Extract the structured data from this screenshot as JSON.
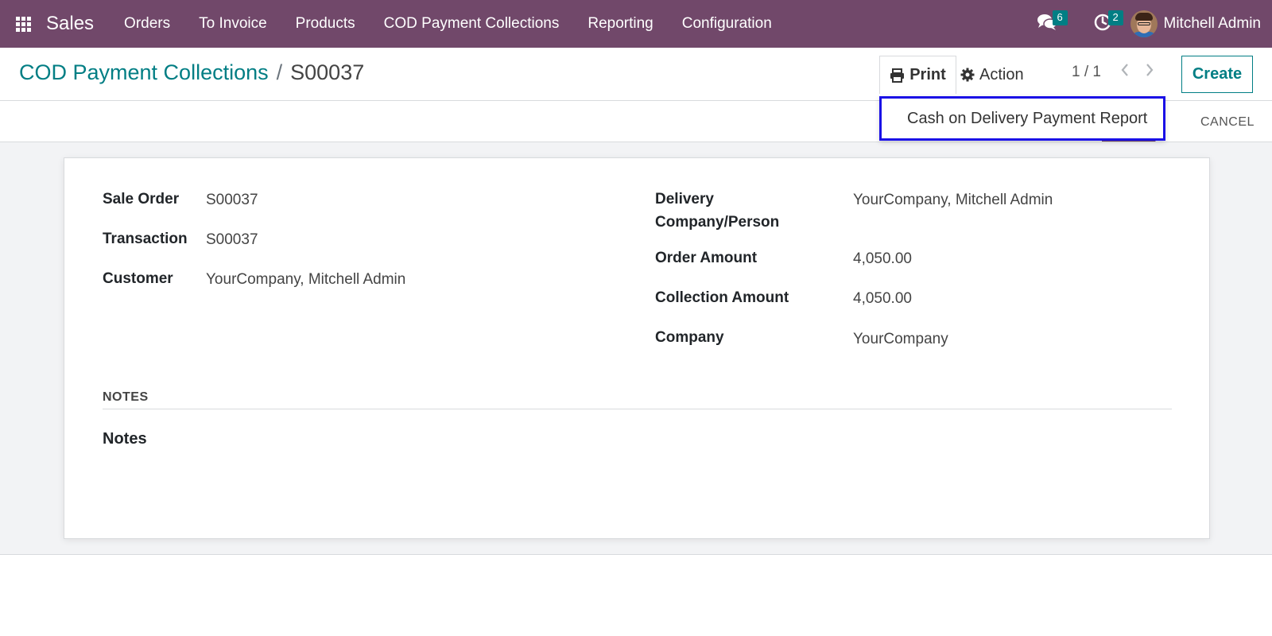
{
  "navbar": {
    "app_name": "Sales",
    "menu": [
      {
        "label": "Orders"
      },
      {
        "label": "To Invoice"
      },
      {
        "label": "Products"
      },
      {
        "label": "COD Payment Collections"
      },
      {
        "label": "Reporting"
      },
      {
        "label": "Configuration"
      }
    ],
    "messages_count": "6",
    "activities_count": "2",
    "user_name": "Mitchell Admin",
    "bg_color": "#71486a",
    "badge_color": "#017e84"
  },
  "breadcrumb": {
    "parent": "COD Payment Collections",
    "separator": "/",
    "current": "S00037"
  },
  "toolbar": {
    "print_label": "Print",
    "action_label": "Action",
    "pager": "1 / 1",
    "create_label": "Create"
  },
  "print_dropdown": {
    "items": [
      {
        "label": "Cash on Delivery Payment Report"
      }
    ],
    "highlight_color": "#1a10e6"
  },
  "statusbar": {
    "cancel_label": "CANCEL"
  },
  "form": {
    "left": [
      {
        "label": "Sale Order",
        "value": "S00037"
      },
      {
        "label": "Transaction",
        "value": "S00037"
      },
      {
        "label": "Customer",
        "value": "YourCompany, Mitchell Admin"
      }
    ],
    "right": [
      {
        "label_line1": "Delivery",
        "label_line2": "Company/Person",
        "value": "YourCompany, Mitchell Admin"
      },
      {
        "label": "Order Amount",
        "value": "4,050.00"
      },
      {
        "label": "Collection Amount",
        "value": "4,050.00"
      },
      {
        "label": "Company",
        "value": "YourCompany"
      }
    ],
    "notes_section_title": "NOTES",
    "notes_label": "Notes"
  }
}
